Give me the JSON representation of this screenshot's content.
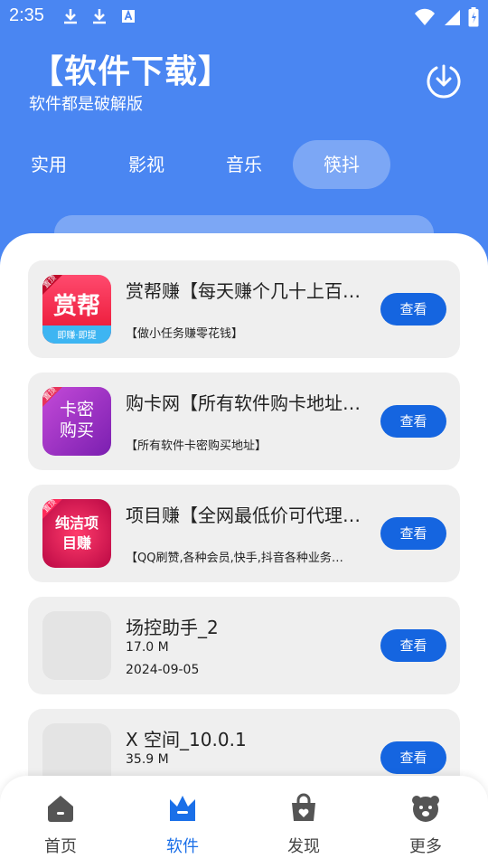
{
  "status_bar": {
    "time": "2:35"
  },
  "header": {
    "title": "【软件下载】",
    "subtitle": "软件都是破解版"
  },
  "tabs": [
    {
      "label": "实用",
      "active": false
    },
    {
      "label": "影视",
      "active": false
    },
    {
      "label": "音乐",
      "active": false
    },
    {
      "label": "筷抖",
      "active": true
    }
  ],
  "cards": [
    {
      "name": "赏帮赚【每天赚个几十上百…",
      "desc": "【做小任务赚零花钱】",
      "thumb_text": "赏帮",
      "thumb_sub": "即赚·即提",
      "badge": "置顶",
      "button": "查看"
    },
    {
      "name": "购卡网【所有软件购卡地址…",
      "desc": "【所有软件卡密购买地址】",
      "thumb_text": "卡密购买",
      "badge": "置顶",
      "button": "查看"
    },
    {
      "name": "项目赚【全网最低价可代理…",
      "desc": "【QQ刷赞,各种会员,快手,抖音各种业务…",
      "thumb_text": "纯洁项目赚",
      "badge": "置顶",
      "button": "查看"
    },
    {
      "name": "场控助手_2",
      "size": "17.0 M",
      "date": "2024-09-05",
      "button": "查看"
    },
    {
      "name": "X 空间_10.0.1",
      "size": "35.9 M",
      "button": "查看"
    }
  ],
  "bottom_nav": [
    {
      "label": "首页",
      "icon": "home-icon",
      "active": false
    },
    {
      "label": "软件",
      "icon": "crown-icon",
      "active": true
    },
    {
      "label": "发现",
      "icon": "bag-icon",
      "active": false
    },
    {
      "label": "更多",
      "icon": "bear-icon",
      "active": false
    }
  ],
  "colors": {
    "header_blue": "#4a86f2",
    "button_blue": "#1565e0",
    "active_nav": "#1a6fe8"
  }
}
